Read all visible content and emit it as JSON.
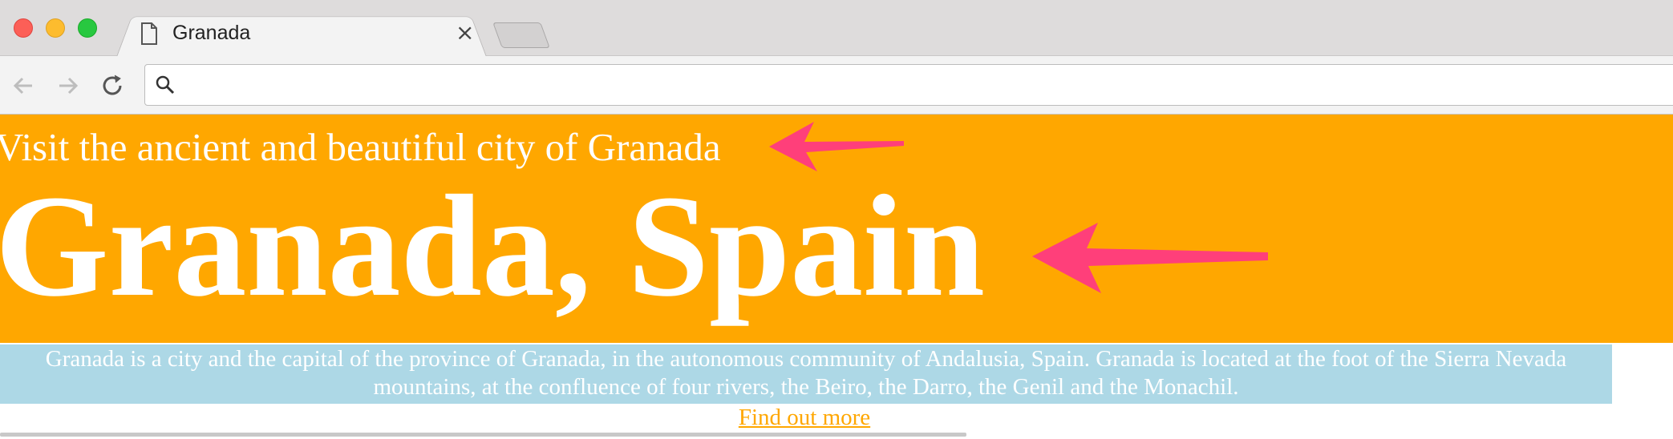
{
  "browser": {
    "tab": {
      "title": "Granada"
    },
    "address": {
      "value": ""
    }
  },
  "page": {
    "tagline": "Visit the ancient and beautiful city of Granada",
    "title": "Granada, Spain",
    "description": "Granada is a city and the capital of the province of Granada, in the autonomous community of Andalusia, Spain. Granada is located at the foot of the Sierra Nevada mountains, at the confluence of four rivers, the Beiro, the Darro, the Genil and the Monachil.",
    "link": "Find out more"
  },
  "colors": {
    "hero_background": "#ffa700",
    "description_background": "#add8e6",
    "annotation_arrow": "#ff3f7a",
    "link": "#ffa700"
  },
  "icons": [
    "close-icon",
    "document-icon",
    "back-icon",
    "forward-icon",
    "reload-icon",
    "search-icon",
    "arrow-annotation"
  ]
}
